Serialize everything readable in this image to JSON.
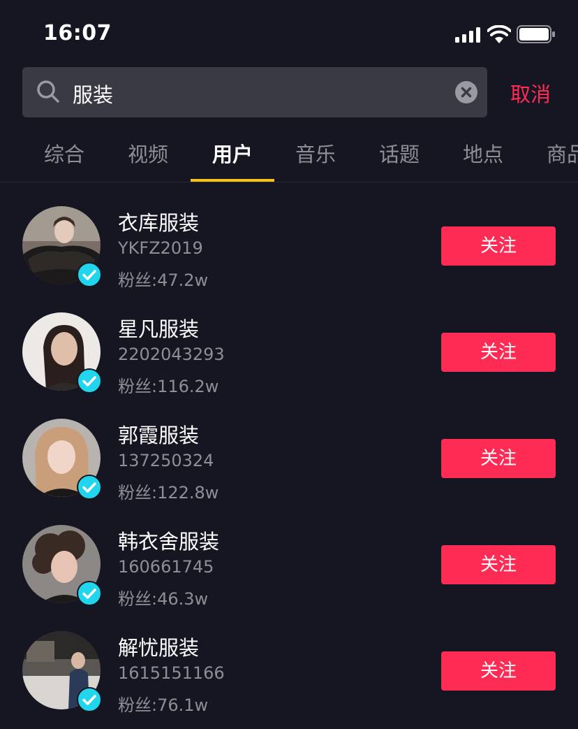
{
  "status_bar": {
    "time": "16:07",
    "icons": [
      "signal-icon",
      "wifi-icon",
      "battery-icon"
    ]
  },
  "search": {
    "value": "服装",
    "cancel_label": "取消",
    "icons": [
      "search-icon",
      "clear-icon"
    ]
  },
  "tabs": [
    {
      "label": "综合",
      "active": false
    },
    {
      "label": "视频",
      "active": false
    },
    {
      "label": "用户",
      "active": true
    },
    {
      "label": "音乐",
      "active": false
    },
    {
      "label": "话题",
      "active": false
    },
    {
      "label": "地点",
      "active": false
    },
    {
      "label": "商品",
      "active": false
    }
  ],
  "users": [
    {
      "name": "衣库服装",
      "id": "YKFZ2019",
      "fans": "粉丝:47.2w",
      "follow_label": "关注",
      "verified": true
    },
    {
      "name": "星凡服装",
      "id": "2202043293",
      "fans": "粉丝:116.2w",
      "follow_label": "关注",
      "verified": true
    },
    {
      "name": "郭霞服装",
      "id": "137250324",
      "fans": "粉丝:122.8w",
      "follow_label": "关注",
      "verified": true
    },
    {
      "name": "韩衣舍服装",
      "id": "160661745",
      "fans": "粉丝:46.3w",
      "follow_label": "关注",
      "verified": true
    },
    {
      "name": "解忧服装",
      "id": "1615151166",
      "fans": "粉丝:76.1w",
      "follow_label": "关注",
      "verified": true
    }
  ],
  "colors": {
    "background": "#161622",
    "accent": "#fe2c55",
    "tab_indicator": "#f5c11b",
    "verified": "#20d5ec",
    "secondary_text": "#8e8e96"
  }
}
